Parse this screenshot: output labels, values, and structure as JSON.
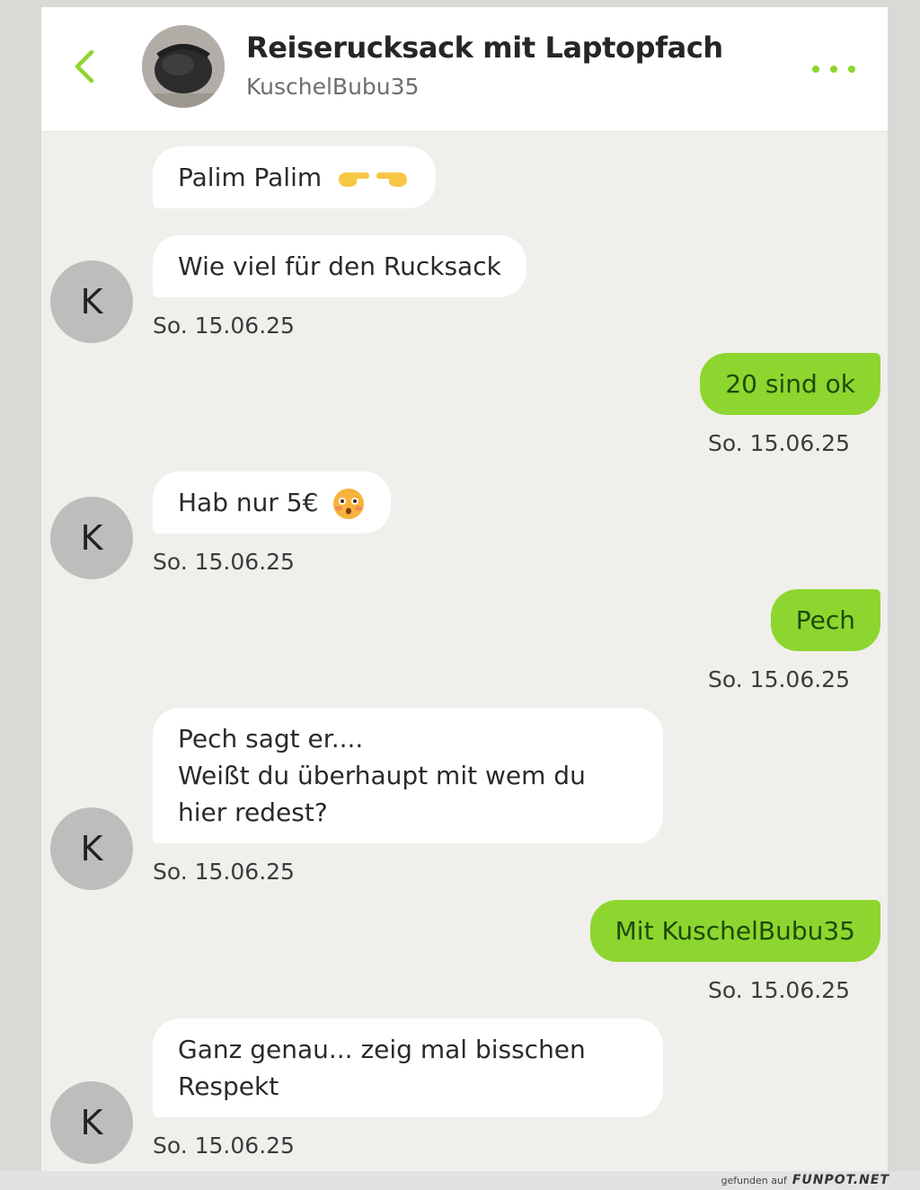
{
  "header": {
    "back_icon": "chevron-left-icon",
    "title": "Reiserucksack mit Laptopfach",
    "subtitle": "KuschelBubu35",
    "more_icon": "more-dots-icon"
  },
  "colors": {
    "accent": "#8dd62f",
    "chat_background": "#f1efec",
    "incoming_bubble": "#ffffff",
    "avatar": "#bdbdbb"
  },
  "avatar_letter": "K",
  "messages": [
    {
      "direction": "in",
      "lines": [
        "Palim Palim"
      ],
      "emoji": "pointing-hands-emoji"
    },
    {
      "direction": "in",
      "lines": [
        "Wie viel für den Rucksack"
      ],
      "timestamp": "So. 15.06.25"
    },
    {
      "direction": "out",
      "lines": [
        "20 sind ok"
      ],
      "timestamp": "So. 15.06.25"
    },
    {
      "direction": "in",
      "lines": [
        "Hab nur 5€"
      ],
      "emoji": "flushed-face-emoji",
      "timestamp": "So. 15.06.25"
    },
    {
      "direction": "out",
      "lines": [
        "Pech"
      ],
      "timestamp": "So. 15.06.25"
    },
    {
      "direction": "in",
      "lines": [
        "Pech sagt er....",
        "Weißt du überhaupt mit wem du",
        "hier redest?"
      ],
      "timestamp": "So. 15.06.25"
    },
    {
      "direction": "out",
      "lines": [
        "Mit KuschelBubu35"
      ],
      "timestamp": "So. 15.06.25"
    },
    {
      "direction": "in",
      "lines": [
        "Ganz genau... zeig mal bisschen",
        "Respekt"
      ],
      "timestamp": "So. 15.06.25"
    }
  ],
  "watermark": {
    "prefix": "gefunden auf",
    "brand": "FUNPOT.NET"
  }
}
